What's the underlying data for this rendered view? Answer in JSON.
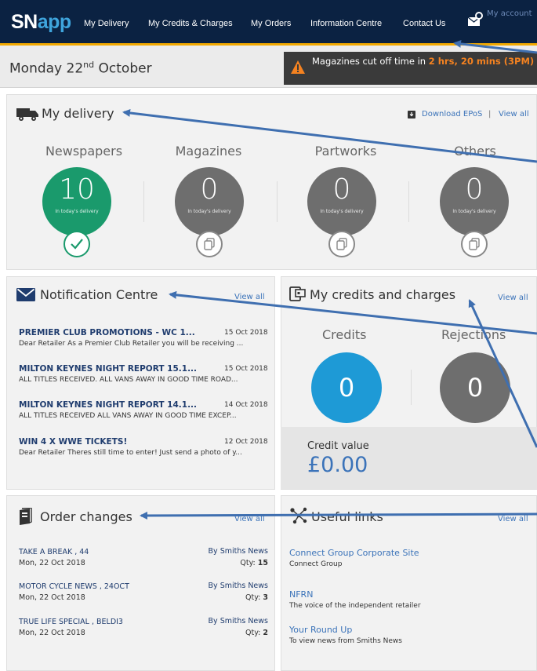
{
  "brand": {
    "part1": "SN",
    "part2": "app"
  },
  "nav": {
    "items": [
      "My Delivery",
      "My Credits & Charges",
      "My Orders",
      "Information Centre",
      "Contact Us"
    ],
    "account": "My account"
  },
  "header": {
    "date_prefix": "Monday 22",
    "date_suffix": "nd",
    "date_rest": " October",
    "alert_prefix": "Magazines cut off time in ",
    "alert_highlight": "2 hrs, 20 mins (3PM)"
  },
  "delivery": {
    "title": "My delivery",
    "download": "Download EPoS",
    "separator": "|",
    "view_all": "View all",
    "sub_label": "In today's delivery",
    "categories": [
      {
        "label": "Newspapers",
        "count": "10",
        "color": "#1a9a6c"
      },
      {
        "label": "Magazines",
        "count": "0",
        "color": "#6e6e6e"
      },
      {
        "label": "Partworks",
        "count": "0",
        "color": "#6e6e6e"
      },
      {
        "label": "Others",
        "count": "0",
        "color": "#6e6e6e"
      }
    ]
  },
  "notifications": {
    "title": "Notification Centre",
    "view_all": "View all",
    "items": [
      {
        "title": "PREMIER CLUB PROMOTIONS - WC 1...",
        "date": "15 Oct 2018",
        "body": "Dear Retailer As a Premier Club Retailer you will be receiving ..."
      },
      {
        "title": "MILTON KEYNES NIGHT REPORT 15.1...",
        "date": "15 Oct 2018",
        "body": "ALL TITLES RECEIVED. ALL VANS AWAY IN GOOD TIME ROAD..."
      },
      {
        "title": "MILTON KEYNES NIGHT REPORT 14.1...",
        "date": "14 Oct 2018",
        "body": "ALL TITLES RECEIVED ALL VANS AWAY IN GOOD TIME EXCEP..."
      },
      {
        "title": "WIN 4 X WWE TICKETS!",
        "date": "12 Oct 2018",
        "body": "Dear Retailer Theres still time to enter! Just send a photo of y..."
      }
    ]
  },
  "credits": {
    "title": "My credits and charges",
    "view_all": "View all",
    "credits_label": "Credits",
    "credits_value": "0",
    "rejections_label": "Rejections",
    "rejections_value": "0",
    "credit_value_label": "Credit value",
    "credit_value_amount": "£0.00",
    "colors": {
      "credits": "#1e9ad6",
      "rejections": "#6e6e6e"
    }
  },
  "orders": {
    "title": "Order changes",
    "view_all": "View all",
    "items": [
      {
        "title": "TAKE A BREAK , 44",
        "date": "Mon, 22 Oct 2018",
        "by": "By Smiths News",
        "qty_label": "Qty: ",
        "qty": "15"
      },
      {
        "title": "MOTOR CYCLE NEWS , 24OCT",
        "date": "Mon, 22 Oct 2018",
        "by": "By Smiths News",
        "qty_label": "Qty: ",
        "qty": "3"
      },
      {
        "title": "TRUE LIFE SPECIAL , BELDI3",
        "date": "Mon, 22 Oct 2018",
        "by": "By Smiths News",
        "qty_label": "Qty: ",
        "qty": "2"
      }
    ]
  },
  "useful_links": {
    "title": "Useful links",
    "view_all": "View all",
    "items": [
      {
        "label": "Connect Group Corporate Site",
        "desc": "Connect Group"
      },
      {
        "label": "NFRN",
        "desc": "The voice of the independent retailer"
      },
      {
        "label": "Your Round Up",
        "desc": "To view news from Smiths News"
      }
    ]
  },
  "colors": {
    "nav_bg": "#0b2242",
    "nav_accent": "#f2a900",
    "link": "#3b73b9",
    "annotation_arrow": "#3f6fb0"
  }
}
